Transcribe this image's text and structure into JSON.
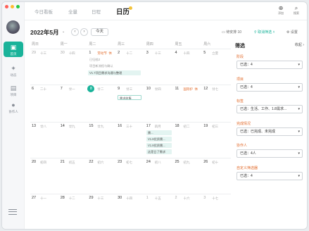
{
  "nav": [
    {
      "label": "首页",
      "icon": "calendar-icon"
    },
    {
      "label": "动态",
      "icon": "activity-icon"
    },
    {
      "label": "项目",
      "icon": "folder-icon"
    },
    {
      "label": "协作人",
      "icon": "people-icon"
    }
  ],
  "tabs": {
    "home": "今日看板",
    "board": "全量",
    "schedule": "日程",
    "calendar": "日历"
  },
  "actions": {
    "add": "添加",
    "search": "搜索"
  },
  "header": {
    "month": "2022年5月",
    "today": "今天",
    "pending": "待安排 10",
    "filter_toggle": "取消筛选",
    "settings": "设置"
  },
  "weekdays": [
    "周日",
    "周一",
    "周二",
    "周三",
    "周四",
    "周五",
    "周六"
  ],
  "weeks": [
    [
      {
        "d": "29",
        "l": "十三",
        "m": true
      },
      {
        "d": "30",
        "l": "十四",
        "m": true
      },
      {
        "d": "1",
        "l": "劳动节",
        "h": "休"
      },
      {
        "d": "2",
        "l": "十二"
      },
      {
        "d": "3",
        "l": "十三"
      },
      {
        "d": "4",
        "l": "十四"
      },
      {
        "d": "5",
        "l": "立夏"
      }
    ],
    [
      {
        "d": "6",
        "l": "二十"
      },
      {
        "d": "7",
        "l": "廿一"
      },
      {
        "d": "8",
        "l": "廿二",
        "today": true
      },
      {
        "d": "9",
        "l": "廿三"
      },
      {
        "d": "10",
        "l": "廿四"
      },
      {
        "d": "11",
        "l": "国际护",
        "h": "休"
      },
      {
        "d": "12",
        "l": "廿七"
      }
    ],
    [
      {
        "d": "13",
        "l": "廿八"
      },
      {
        "d": "14",
        "l": "廿九"
      },
      {
        "d": "15",
        "l": "廿九"
      },
      {
        "d": "16",
        "l": "三十"
      },
      {
        "d": "17",
        "l": "四月"
      },
      {
        "d": "18",
        "l": "初二"
      },
      {
        "d": "19",
        "l": "初三"
      }
    ],
    [
      {
        "d": "20",
        "l": "初四"
      },
      {
        "d": "21",
        "l": "初五"
      },
      {
        "d": "22",
        "l": "初六"
      },
      {
        "d": "23",
        "l": "初七"
      },
      {
        "d": "24",
        "l": "初八"
      },
      {
        "d": "25",
        "l": "初九"
      },
      {
        "d": "26",
        "l": "初十"
      }
    ],
    [
      {
        "d": "27",
        "l": "十一"
      },
      {
        "d": "28",
        "l": "十二"
      },
      {
        "d": "29",
        "l": "十三"
      },
      {
        "d": "30",
        "l": "十四"
      },
      {
        "d": "1",
        "l": "十五",
        "m": true
      },
      {
        "d": "2",
        "l": "十六",
        "m": true
      },
      {
        "d": "3",
        "l": "十七",
        "m": true
      }
    ]
  ],
  "events": {
    "e1": "已归档3",
    "e2": "项目新流程与确认",
    "e3": "V1.7项目需求沟通与整理",
    "e4": "需求收集",
    "e5": "需...",
    "e6": "V1.8优质需...",
    "e7": "V1.8优质需...",
    "e8": "这是日了需求"
  },
  "filter": {
    "title": "筛选",
    "collapse": "收起",
    "groups": [
      {
        "label": "阶段",
        "value": "已选：4"
      },
      {
        "label": "项目",
        "value": "已选：4"
      },
      {
        "label": "标签",
        "value": "已选：生活、工作、1.8需求..."
      },
      {
        "label": "完成情况",
        "value": "已选：已完成、未完成"
      },
      {
        "label": "协作人",
        "value": "已选：4人"
      },
      {
        "label": "自定义筛选器",
        "value": "已选：4"
      }
    ]
  },
  "colors": {
    "accent": "#1ab39a",
    "holiday": "#e26b2b"
  }
}
